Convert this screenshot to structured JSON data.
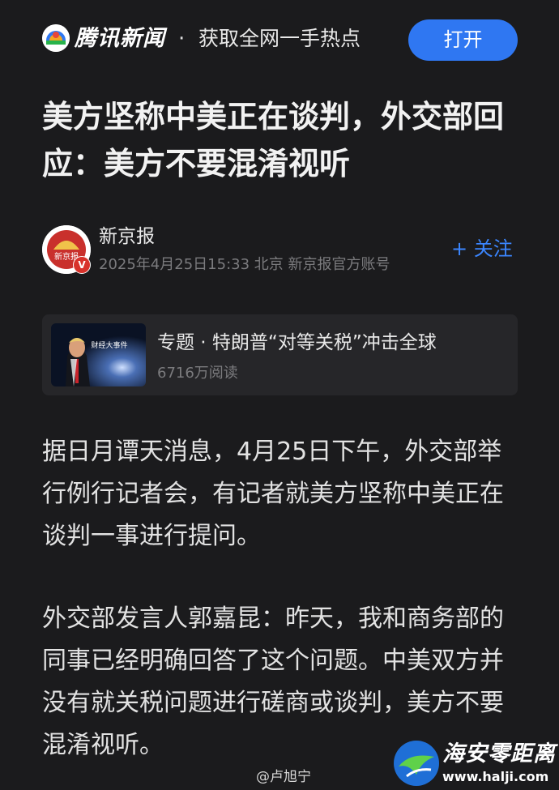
{
  "banner": {
    "app_name": "腾讯新闻",
    "separator": "·",
    "tagline": "获取全网一手热点",
    "open_label": "打开"
  },
  "article": {
    "headline": "美方坚称中美正在谈判，外交部回应：美方不要混淆视听"
  },
  "author": {
    "name": "新京报",
    "avatar_text": "新京报",
    "badge": "V",
    "meta": "2025年4月25日15:33  北京  新京报官方账号",
    "follow_label": "+ 关注"
  },
  "topic": {
    "thumb_caption": "财经大事件",
    "title": "专题 · 特朗普“对等关税”冲击全球",
    "reads": "6716万阅读"
  },
  "body": {
    "para1": "据日月谭天消息，4月25日下午，外交部举行例行记者会，有记者就美方坚称中美正在谈判一事进行提问。",
    "para2": "外交部发言人郭嘉昆：昨天，我和商务部的同事已经明确回答了这个问题。中美双方并没有就关税问题进行磋商或谈判，美方不要混淆视听。"
  },
  "watermark": {
    "credit": "@卢旭宁",
    "site_name": "海安零距离",
    "site_url": "www.halji.com"
  },
  "colors": {
    "background": "#1b1b1d",
    "accent_blue": "#2f77f2",
    "follow_blue": "#3b86ff",
    "card_bg": "#262629",
    "meta_gray": "#7b7b7e"
  }
}
